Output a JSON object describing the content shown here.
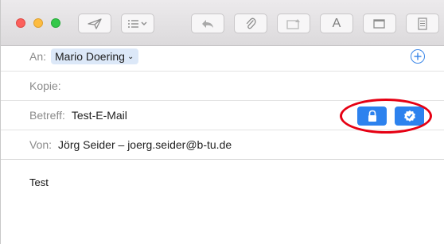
{
  "header": {
    "to_label": "An:",
    "to_recipient": "Mario Doering",
    "cc_label": "Kopie:",
    "subject_label": "Betreff:",
    "subject_value": "Test-E-Mail",
    "from_label": "Von:",
    "from_value": "Jörg Seider – joerg.seider@b-tu.de"
  },
  "toolbar": {
    "format_button_glyph": "A"
  },
  "message": {
    "body_text": "Test"
  },
  "colors": {
    "accent": "#2d82ee",
    "highlight_circle": "#e60013"
  },
  "icons": [
    "send-icon",
    "header-fields-icon",
    "reply-icon",
    "attach-icon",
    "photo-browser-icon",
    "format-icon",
    "window-icon",
    "stationery-icon",
    "add-recipient-icon",
    "lock-icon",
    "certificate-icon"
  ]
}
